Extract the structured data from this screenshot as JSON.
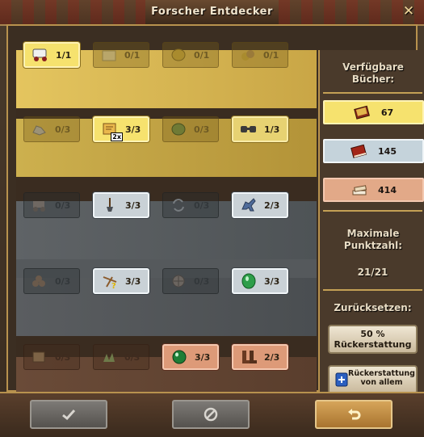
{
  "window": {
    "title": "Forscher Entdecker",
    "close_glyph": "✕"
  },
  "rows": [
    {
      "tier": "gold",
      "tiles": [
        {
          "icon": "supply-wagon-icon",
          "count": "1/1",
          "active": true
        },
        {
          "icon": "crate-icon",
          "count": "0/1",
          "active": false
        },
        {
          "icon": "gold-coin-icon",
          "count": "0/1",
          "active": false
        },
        {
          "icon": "coin-pile-icon",
          "count": "0/1",
          "active": false
        }
      ]
    },
    {
      "tier": "gold",
      "tiles": [
        {
          "icon": "ore-icon",
          "count": "0/3",
          "active": false
        },
        {
          "icon": "treasure-map-2x-icon",
          "count": "3/3",
          "active": true,
          "badge": "2x"
        },
        {
          "icon": "green-gem-icon",
          "count": "0/3",
          "active": false
        },
        {
          "icon": "binoculars-icon",
          "count": "1/3",
          "active": true
        }
      ]
    },
    {
      "tier": "silver",
      "tiles": [
        {
          "icon": "cart-icon",
          "count": "0/3",
          "active": false
        },
        {
          "icon": "shovel-icon",
          "count": "3/3",
          "active": true
        },
        {
          "icon": "refresh-arrows-icon",
          "count": "0/3",
          "active": false
        },
        {
          "icon": "donkey-icon",
          "count": "2/3",
          "active": true
        }
      ]
    },
    {
      "tier": "silver",
      "tiles": [
        {
          "icon": "logs-icon",
          "count": "0/3",
          "active": false
        },
        {
          "icon": "map-marker-question-icon",
          "count": "3/3",
          "active": true
        },
        {
          "icon": "compass-icon",
          "count": "0/3",
          "active": false
        },
        {
          "icon": "emerald-icon",
          "count": "3/3",
          "active": true
        }
      ]
    },
    {
      "tier": "bronze",
      "tiles": [
        {
          "icon": "map-roll-icon",
          "count": "0/3",
          "active": false
        },
        {
          "icon": "herbs-icon",
          "count": "0/3",
          "active": false
        },
        {
          "icon": "green-orb-icon",
          "count": "3/3",
          "active": true
        },
        {
          "icon": "boots-icon",
          "count": "2/3",
          "active": true
        }
      ]
    }
  ],
  "panel": {
    "books_heading": "Verfügbare Bücher:",
    "books": [
      {
        "tier": "gold",
        "icon": "gold-book-icon",
        "value": "67"
      },
      {
        "tier": "silver",
        "icon": "red-book-icon",
        "value": "145"
      },
      {
        "tier": "bronze",
        "icon": "book-stack-icon",
        "value": "414"
      }
    ],
    "max_points_heading": "Maximale Punktzahl:",
    "max_points_value": "21/21",
    "reset_heading": "Zurücksetzen:",
    "refund_50_line1": "50 %",
    "refund_50_line2": "Rückerstattung",
    "refund_all_line1": "Rückerstattung",
    "refund_all_line2": "von allem"
  },
  "footer": {
    "confirm_icon": "checkmark-icon",
    "cancel_icon": "no-entry-icon",
    "undo_icon": "undo-arrow-icon"
  }
}
